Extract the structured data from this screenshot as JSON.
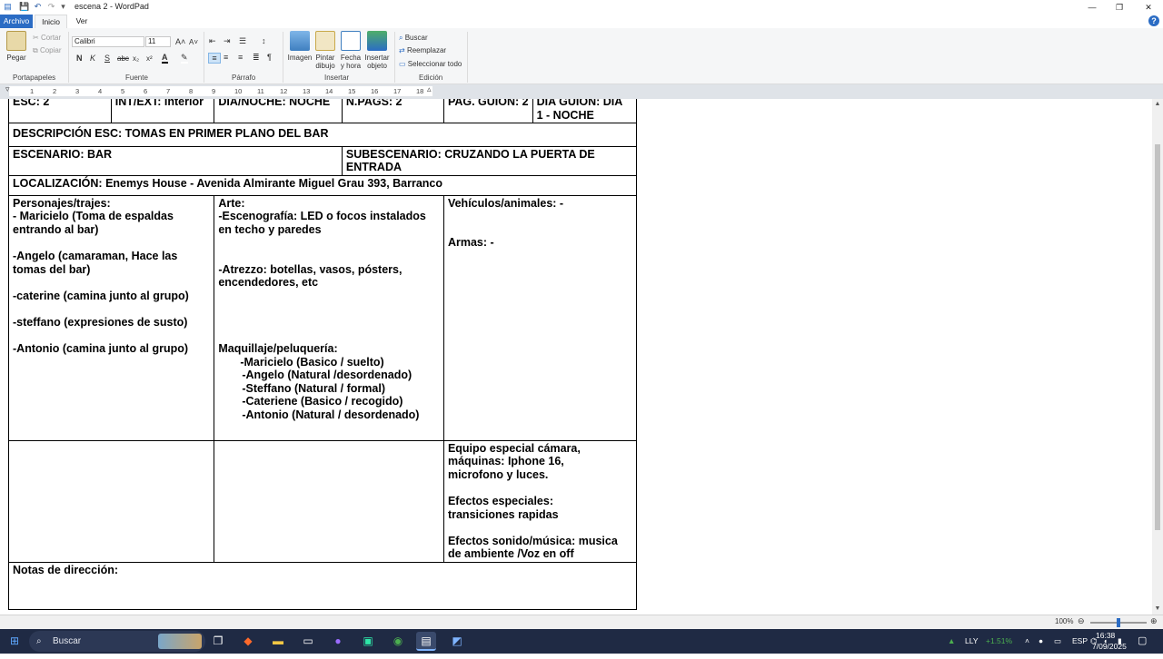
{
  "window": {
    "title": "escena 2 - WordPad",
    "min": "—",
    "max": "❐",
    "close": "✕"
  },
  "quick_access": {
    "save": "💾",
    "undo": "↶",
    "redo": "↷",
    "more": "▾"
  },
  "tabs": [
    {
      "label": "Archivo",
      "active": false
    },
    {
      "label": "Inicio",
      "active": true
    },
    {
      "label": "Ver",
      "active": false
    }
  ],
  "help_icon": "?",
  "ribbon": {
    "clipboard": {
      "group": "Portapapeles",
      "paste": "Pegar",
      "cut": "Cortar",
      "copy": "Copiar"
    },
    "font": {
      "group": "Fuente",
      "family": "Calibri",
      "size": "11",
      "bold": "N",
      "italic": "K",
      "underline": "S",
      "strike": "abc",
      "sub": "x₂",
      "sup": "x²"
    },
    "paragraph": {
      "group": "Párrafo"
    },
    "insert": {
      "group": "Insertar",
      "image": "Imagen",
      "paint_1": "Pintar",
      "paint_2": "dibujo",
      "date_1": "Fecha",
      "date_2": "y hora",
      "obj_1": "Insertar",
      "obj_2": "objeto"
    },
    "edit": {
      "group": "Edición",
      "find": "Buscar",
      "replace": "Reemplazar",
      "select_all": "Seleccionar todo"
    }
  },
  "ruler": {
    "marks": [
      "1",
      "2",
      "3",
      "4",
      "5",
      "6",
      "7",
      "8",
      "9",
      "10",
      "11",
      "12",
      "13",
      "14",
      "15",
      "16",
      "17",
      "18"
    ]
  },
  "document": {
    "row1": {
      "esc": "ESC: 2",
      "int_ext": "INT/EXT: Interior",
      "dia_noche": "DIA/NOCHE: NOCHE",
      "npags": "N.PAGS: 2",
      "pag_guion": "PAG. GUION: 2",
      "dia_guion_1": "DIA GUION: DIA",
      "dia_guion_2": "1 - NOCHE"
    },
    "descripcion": "DESCRIPCIÓN ESC: TOMAS EN PRIMER PLANO DEL BAR",
    "escenario": "ESCENARIO: BAR",
    "subescenario_1": "SUBESCENARIO: CRUZANDO LA PUERTA DE",
    "subescenario_2": "ENTRADA",
    "localizacion": "LOCALIZACIÓN: Enemys House - Avenida Almirante Miguel Grau 393, Barranco",
    "personajes": [
      "Personajes/trajes:",
      "- Maricielo (Toma de espaldas",
      "entrando al bar)",
      "",
      "-Angelo (camaraman, Hace las",
      "tomas del bar)",
      "",
      "-caterine (camina junto al grupo)",
      "",
      "-steffano (expresiones de susto)",
      "",
      "-Antonio (camina junto al grupo)"
    ],
    "arte": [
      "Arte:",
      "-Escenografía: LED o focos instalados",
      "en techo y paredes",
      "",
      "",
      "-Atrezzo: botellas, vasos, pósters,",
      "encendedores, etc",
      "",
      "",
      "",
      "",
      "Maquillaje/peluquería:",
      "      -Maricielo (Basico / suelto)",
      "       -Angelo (Natural /desordenado)",
      "       -Steffano (Natural / formal)",
      "       -Cateriene (Basico / recogido)",
      "       -Antonio (Natural / desordenado)"
    ],
    "vehiculos": [
      "Vehículos/animales: -",
      "",
      "",
      "Armas: -"
    ],
    "equipo": [
      "Equipo especial cámara,",
      "máquinas: Iphone 16,",
      "microfono y luces.",
      "",
      "Efectos especiales:",
      "transiciones rapidas",
      "",
      "Efectos sonido/música: musica",
      "de ambiente /Voz en off"
    ],
    "notas": "Notas de dirección:"
  },
  "status": {
    "zoom": "100%",
    "zoom_out": "⊖",
    "zoom_in": "⊕"
  },
  "taskbar": {
    "search_placeholder": "Buscar",
    "stock": "LLY",
    "stock_change": "+1.51%",
    "lang": "ESP",
    "time": "16:38",
    "date": "7/09/2025"
  },
  "colors": {
    "accent": "#2b6cc4",
    "taskbar": "#1f2a44",
    "ribbon": "#f5f6f7",
    "stock_up": "#4caf50"
  }
}
